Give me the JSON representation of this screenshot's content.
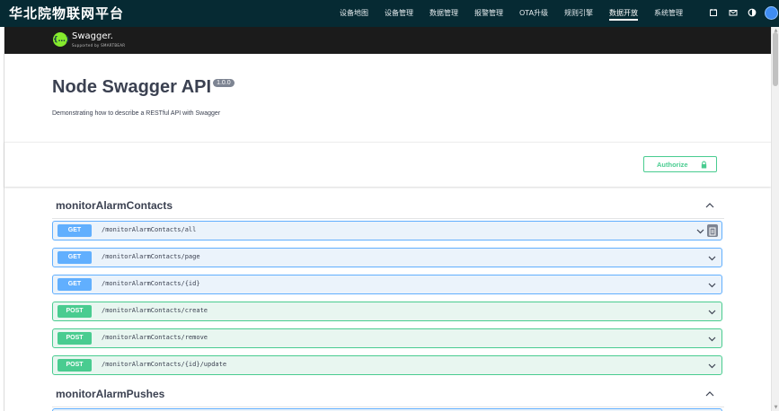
{
  "app": {
    "title": "华北院物联网平台"
  },
  "topnav": {
    "items": [
      {
        "label": "设备地图"
      },
      {
        "label": "设备管理"
      },
      {
        "label": "数据管理"
      },
      {
        "label": "报警管理"
      },
      {
        "label": "OTA升级"
      },
      {
        "label": "规则引擎"
      },
      {
        "label": "数据开放",
        "active": true
      },
      {
        "label": "系统管理"
      }
    ],
    "icons": [
      "calendar-icon",
      "mail-icon",
      "theme-toggle-icon",
      "user-avatar"
    ]
  },
  "swagger": {
    "logo_text": "Swagger.",
    "logo_subtext": "Supported by SMARTBEAR",
    "title": "Node Swagger API",
    "version": "1.0.0",
    "description": "Demonstrating how to describe a RESTful API with Swagger",
    "authorize_label": "Authorize"
  },
  "tags": [
    {
      "name": "monitorAlarmContacts",
      "expanded": true,
      "operations": [
        {
          "method": "GET",
          "path": "/monitorAlarmContacts/all"
        },
        {
          "method": "GET",
          "path": "/monitorAlarmContacts/page"
        },
        {
          "method": "GET",
          "path": "/monitorAlarmContacts/{id}"
        },
        {
          "method": "POST",
          "path": "/monitorAlarmContacts/create"
        },
        {
          "method": "POST",
          "path": "/monitorAlarmContacts/remove"
        },
        {
          "method": "POST",
          "path": "/monitorAlarmContacts/{id}/update"
        }
      ]
    },
    {
      "name": "monitorAlarmPushes",
      "expanded": true,
      "operations": []
    }
  ],
  "colors": {
    "header_bg": "#062a33",
    "get": "#61affe",
    "post": "#49cc90"
  }
}
